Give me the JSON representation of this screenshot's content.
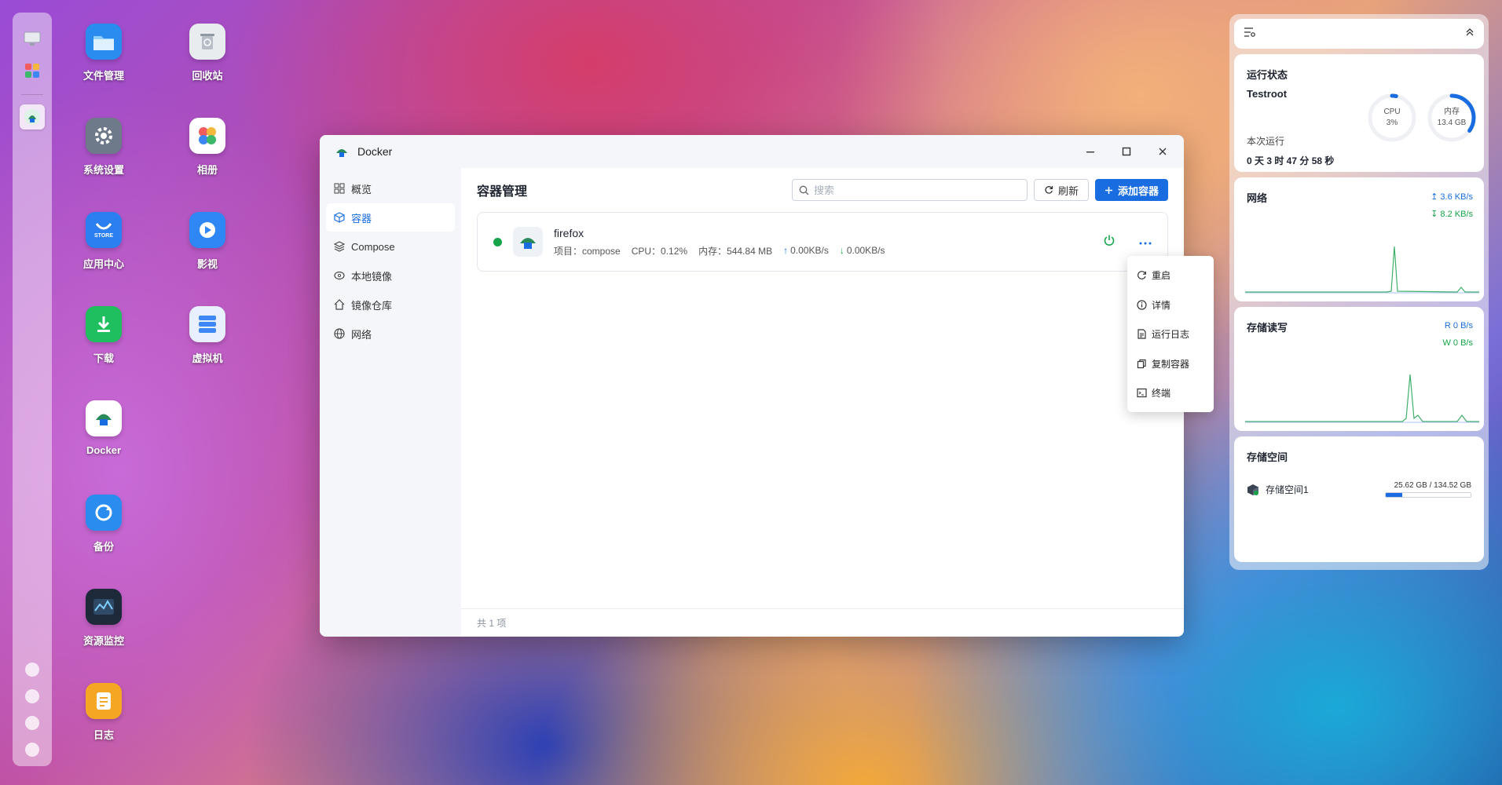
{
  "desktop": {
    "icons": [
      {
        "label": "文件管理",
        "icon": "folder-icon"
      },
      {
        "label": "回收站",
        "icon": "trash-icon"
      },
      {
        "label": "系统设置",
        "icon": "gear-icon"
      },
      {
        "label": "相册",
        "icon": "photos-icon"
      },
      {
        "label": "应用中心",
        "icon": "store-icon",
        "badge": "STORE"
      },
      {
        "label": "影视",
        "icon": "video-icon"
      },
      {
        "label": "下载",
        "icon": "download-icon"
      },
      {
        "label": "虚拟机",
        "icon": "vm-icon"
      },
      {
        "label": "Docker",
        "icon": "docker-icon"
      },
      {
        "label": "备份",
        "icon": "backup-icon"
      },
      {
        "label": "资源监控",
        "icon": "monitor-icon"
      },
      {
        "label": "日志",
        "icon": "log-icon"
      }
    ]
  },
  "window": {
    "title": "Docker",
    "sidebar": [
      {
        "label": "概览",
        "icon": "grid-icon"
      },
      {
        "label": "容器",
        "icon": "cube-icon",
        "active": true
      },
      {
        "label": "Compose",
        "icon": "layers-icon"
      },
      {
        "label": "本地镜像",
        "icon": "disc-icon"
      },
      {
        "label": "镜像仓库",
        "icon": "home-icon"
      },
      {
        "label": "网络",
        "icon": "globe-icon"
      }
    ],
    "main": {
      "title": "容器管理",
      "search_placeholder": "搜索",
      "refresh_label": "刷新",
      "add_label": "添加容器",
      "footer": "共 1 项"
    },
    "container": {
      "name": "firefox",
      "project": "项目：compose",
      "cpu": "CPU：0.12%",
      "memory": "内存：544.84 MB",
      "upload": "0.00KB/s",
      "download": "0.00KB/s",
      "status_color": "#16a34a"
    },
    "context_menu": [
      {
        "label": "重启",
        "icon": "restart-icon"
      },
      {
        "label": "详情",
        "icon": "info-icon"
      },
      {
        "label": "运行日志",
        "icon": "file-log-icon"
      },
      {
        "label": "复制容器",
        "icon": "copy-icon"
      },
      {
        "label": "终端",
        "icon": "terminal-icon"
      }
    ]
  },
  "widgets": {
    "status": {
      "title": "运行状态",
      "user": "Testroot",
      "cpu_label": "CPU",
      "cpu_value": "3%",
      "cpu_fraction": 0.03,
      "mem_label": "内存",
      "mem_value": "13.4 GB",
      "mem_fraction": 0.35,
      "uptime_label": "本次运行",
      "uptime": "0 天 3 时 47 分 58 秒"
    },
    "network": {
      "title": "网络",
      "up": "3.6 KB/s",
      "down": "8.2 KB/s"
    },
    "disk_io": {
      "title": "存储读写",
      "read": "R  0 B/s",
      "write": "W  0 B/s"
    },
    "storage": {
      "title": "存储空间",
      "volume_name": "存储空间1",
      "usage_text": "25.62 GB / 134.52 GB",
      "usage_fraction": 0.19
    }
  },
  "colors": {
    "accent": "#1a6de0",
    "success": "#16a34a"
  }
}
